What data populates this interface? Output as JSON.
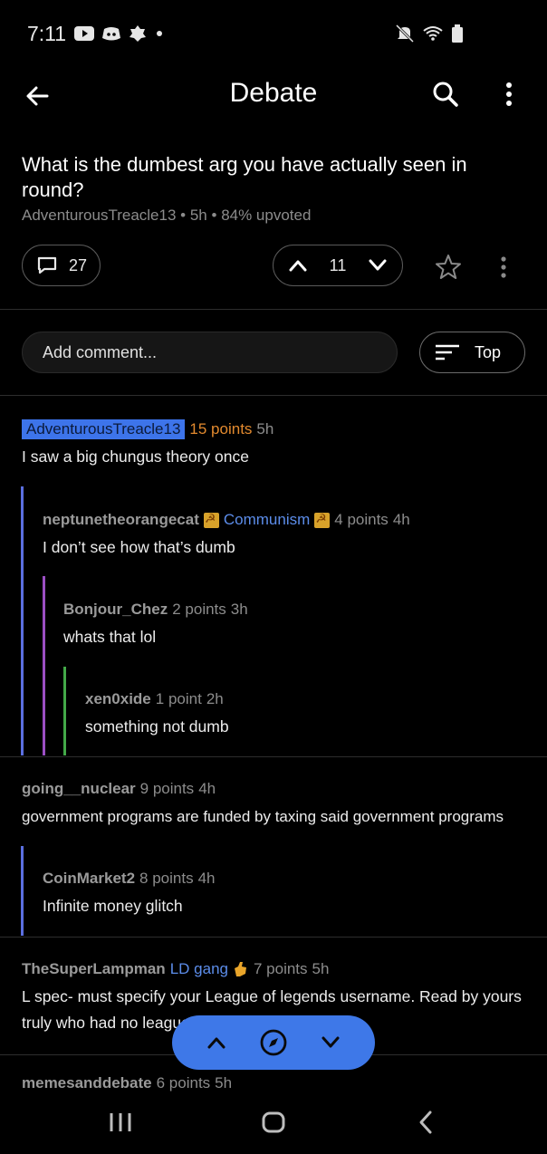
{
  "status_bar": {
    "time": "7:11",
    "icons_left": [
      "youtube-icon",
      "discord-icon",
      "badge-icon",
      "dot-icon"
    ],
    "icons_right": [
      "mute-icon",
      "wifi-icon",
      "battery-icon"
    ]
  },
  "header": {
    "title": "Debate",
    "back_icon": "arrow-left-icon",
    "search_icon": "search-icon",
    "more_icon": "more-vertical-icon"
  },
  "post": {
    "title": "What is the dumbest arg you have actually seen in round?",
    "author": "AdventurousTreacle13",
    "age": "5h",
    "upvoted": "84% upvoted",
    "comment_count": "27",
    "score": "11"
  },
  "comment_bar": {
    "placeholder": "Add comment...",
    "sort_label": "Top"
  },
  "comments": [
    {
      "user": "AdventurousTreacle13",
      "is_op": true,
      "points": "15 points",
      "age": "5h",
      "body": "I saw a big chungus theory once",
      "depth": 0
    },
    {
      "user": "neptunetheorangecat",
      "flair": "Communism",
      "points": "4 points",
      "age": "4h",
      "body": "I don’t see how that’s dumb",
      "depth": 1
    },
    {
      "user": "Bonjour_Chez",
      "points": "2 points",
      "age": "3h",
      "body": "whats that lol",
      "depth": 2
    },
    {
      "user": "xen0xide",
      "points": "1 point",
      "age": "2h",
      "body": "something not dumb",
      "depth": 3
    },
    {
      "user": "going__nuclear",
      "points": "9 points",
      "age": "4h",
      "body": "government programs are funded by taxing said government programs",
      "depth": 0
    },
    {
      "user": "CoinMarket2",
      "points": "8 points",
      "age": "4h",
      "body": "Infinite money glitch",
      "depth": 1
    },
    {
      "user": "TheSuperLampman",
      "flair": "LD gang",
      "points": "7 points",
      "age": "5h",
      "body": "L spec- must specify your League of legends username. Read by yours truly who had no league",
      "depth": 0
    },
    {
      "user": "memesanddebate",
      "points": "6 points",
      "age": "5h",
      "depth": 0
    }
  ],
  "colors": {
    "background": "#000000",
    "accent": "#3e78e8",
    "op_points": "#e38a2e",
    "flair": "#5c8dea",
    "thread_depth_1": "#5b6fe0",
    "thread_depth_2": "#9b4fc4",
    "thread_depth_3": "#43a948"
  }
}
